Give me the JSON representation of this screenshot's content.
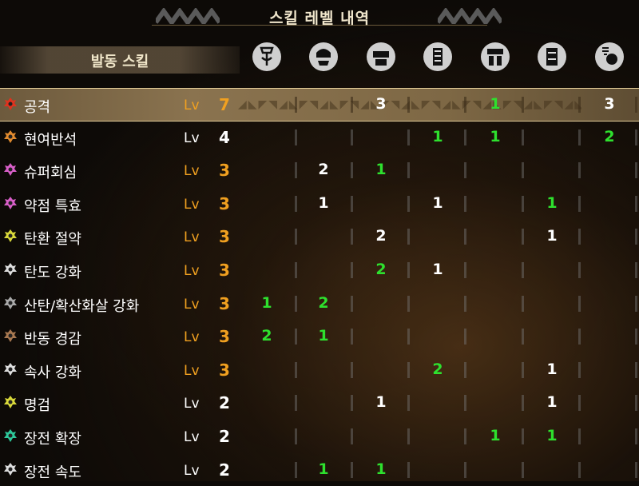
{
  "title": "스킬 레벨 내역",
  "header": {
    "skill_label": "발동 스킬"
  },
  "equipment_icons": [
    {
      "name": "weapon-icon"
    },
    {
      "name": "helmet-icon"
    },
    {
      "name": "chest-armor-icon"
    },
    {
      "name": "arm-armor-icon"
    },
    {
      "name": "waist-armor-icon"
    },
    {
      "name": "leg-armor-icon"
    },
    {
      "name": "charm-icon"
    }
  ],
  "skills": [
    {
      "name": "공격",
      "lv": "Lv",
      "level": "7",
      "level_color": "orange",
      "icon_color": "#e0321e",
      "cells": [
        "",
        "",
        "3",
        "",
        "1",
        "",
        "3"
      ],
      "selected": true
    },
    {
      "name": "현여반석",
      "lv": "Lv",
      "level": "4",
      "level_color": "white",
      "icon_color": "#e08a2e",
      "cells": [
        "",
        "",
        "",
        "1",
        "1",
        "",
        "2"
      ]
    },
    {
      "name": "슈퍼회심",
      "lv": "Lv",
      "level": "3",
      "level_color": "orange",
      "icon_color": "#d85fc8",
      "cells": [
        "",
        "2",
        "1",
        "",
        "",
        "",
        ""
      ]
    },
    {
      "name": "약점 특효",
      "lv": "Lv",
      "level": "3",
      "level_color": "orange",
      "icon_color": "#d85fc8",
      "cells": [
        "",
        "1",
        "",
        "1",
        "",
        "1",
        ""
      ]
    },
    {
      "name": "탄환 절약",
      "lv": "Lv",
      "level": "3",
      "level_color": "orange",
      "icon_color": "#d8d83a",
      "cells": [
        "",
        "",
        "2",
        "",
        "",
        "1",
        ""
      ]
    },
    {
      "name": "탄도 강화",
      "lv": "Lv",
      "level": "3",
      "level_color": "orange",
      "icon_color": "#dddddd",
      "cells": [
        "",
        "",
        "2",
        "1",
        "",
        "",
        ""
      ]
    },
    {
      "name": "산탄/확산화살 강화",
      "lv": "Lv",
      "level": "3",
      "level_color": "orange",
      "icon_color": "#aaaaaa",
      "cells": [
        "1",
        "2",
        "",
        "",
        "",
        "",
        ""
      ]
    },
    {
      "name": "반동 경감",
      "lv": "Lv",
      "level": "3",
      "level_color": "orange",
      "icon_color": "#a87850",
      "cells": [
        "2",
        "1",
        "",
        "",
        "",
        "",
        ""
      ]
    },
    {
      "name": "속사 강화",
      "lv": "Lv",
      "level": "3",
      "level_color": "orange",
      "icon_color": "#dddddd",
      "cells": [
        "",
        "",
        "",
        "2",
        "",
        "1",
        ""
      ]
    },
    {
      "name": "명검",
      "lv": "Lv",
      "level": "2",
      "level_color": "white",
      "icon_color": "#d8d83a",
      "cells": [
        "",
        "",
        "1",
        "",
        "",
        "1",
        ""
      ]
    },
    {
      "name": "장전 확장",
      "lv": "Lv",
      "level": "2",
      "level_color": "white",
      "icon_color": "#2ec89a",
      "cells": [
        "",
        "",
        "",
        "",
        "1",
        "1",
        ""
      ]
    },
    {
      "name": "장전 속도",
      "lv": "Lv",
      "level": "2",
      "level_color": "white",
      "icon_color": "#dddddd",
      "cells": [
        "",
        "1",
        "1",
        "",
        "",
        "",
        ""
      ]
    }
  ],
  "cell_colors": [
    [
      "",
      "",
      "white",
      "",
      "green",
      "",
      "white"
    ],
    [
      "",
      "",
      "",
      "green",
      "green",
      "",
      "green"
    ],
    [
      "",
      "white",
      "green",
      "",
      "",
      "",
      ""
    ],
    [
      "",
      "white",
      "",
      "white",
      "",
      "green",
      ""
    ],
    [
      "",
      "",
      "white",
      "",
      "",
      "white",
      ""
    ],
    [
      "",
      "",
      "green",
      "white",
      "",
      "",
      ""
    ],
    [
      "green",
      "green",
      "",
      "",
      "",
      "",
      ""
    ],
    [
      "green",
      "green",
      "",
      "",
      "",
      "",
      ""
    ],
    [
      "",
      "",
      "",
      "green",
      "",
      "white",
      ""
    ],
    [
      "",
      "",
      "white",
      "",
      "",
      "white",
      ""
    ],
    [
      "",
      "",
      "",
      "",
      "green",
      "green",
      ""
    ],
    [
      "",
      "green",
      "green",
      "",
      "",
      "",
      ""
    ]
  ]
}
